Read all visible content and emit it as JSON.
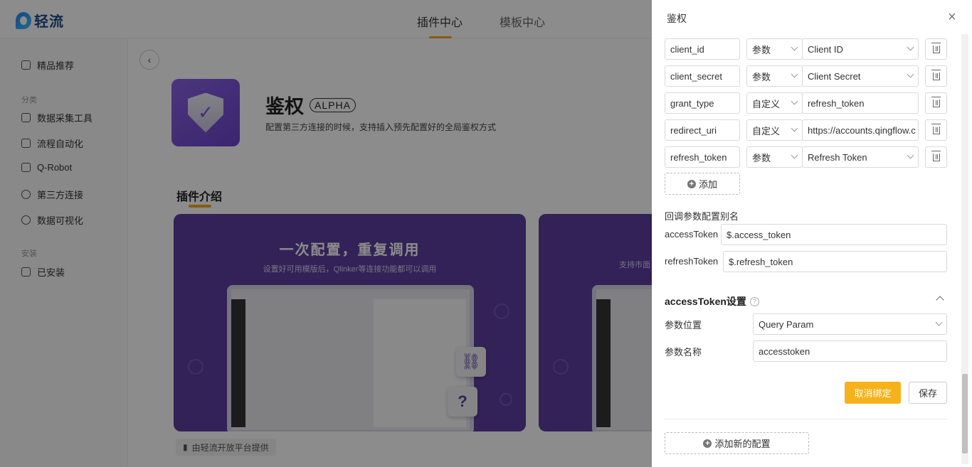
{
  "app": {
    "logo_text": "轻流"
  },
  "top_tabs": [
    {
      "label": "插件中心"
    },
    {
      "label": "模板中心"
    }
  ],
  "sidebar": {
    "featured": "精品推荐",
    "group_category": "分类",
    "categories": [
      "数据采集工具",
      "流程自动化",
      "Q-Robot",
      "第三方连接",
      "数据可视化"
    ],
    "group_installed": "安装",
    "installed": "已安装"
  },
  "plugin": {
    "title": "鉴权",
    "badge": "ALPHA",
    "description": "配置第三方连接的时候，支持插入预先配置好的全局鉴权方式",
    "intro_title": "插件介绍",
    "provider": "由轻流开放平台提供"
  },
  "banner1": {
    "headline": "一次配置，重复调用",
    "subline": "设置好可用模版后，Qlinker等连接功能都可以调用",
    "question_mark": "?"
  },
  "banner2": {
    "subline": "支持市面"
  },
  "drawer": {
    "title": "鉴权",
    "close": "×",
    "params": [
      {
        "name": "client_id",
        "type": "参数",
        "value": "Client ID",
        "value_is_select": true
      },
      {
        "name": "client_secret",
        "type": "参数",
        "value": "Client Secret",
        "value_is_select": true
      },
      {
        "name": "grant_type",
        "type": "自定义",
        "value": "refresh_token",
        "value_is_select": false
      },
      {
        "name": "redirect_uri",
        "type": "自定义",
        "value": "https://accounts.qingflow.c",
        "value_is_select": false
      },
      {
        "name": "refresh_token",
        "type": "参数",
        "value": "Refresh Token",
        "value_is_select": true
      }
    ],
    "add_label": "添加",
    "callback_title": "回调参数配置别名",
    "access_token_label": "accessToken",
    "access_token_value": "$.access_token",
    "refresh_token_label": "refreshToken",
    "refresh_token_value": "$.refresh_token",
    "access_token_settings_title": "accessToken设置",
    "param_position_label": "参数位置",
    "param_position_value": "Query Param",
    "param_name_label": "参数名称",
    "param_name_value": "accesstoken",
    "unbind_label": "取消绑定",
    "save_label": "保存",
    "add_config_label": "添加新的配置"
  },
  "colors": {
    "accent": "#f5a623",
    "primary_button": "#f5b21b",
    "banner": "#5b3e9e",
    "plugin_icon": "#7a55d6"
  }
}
